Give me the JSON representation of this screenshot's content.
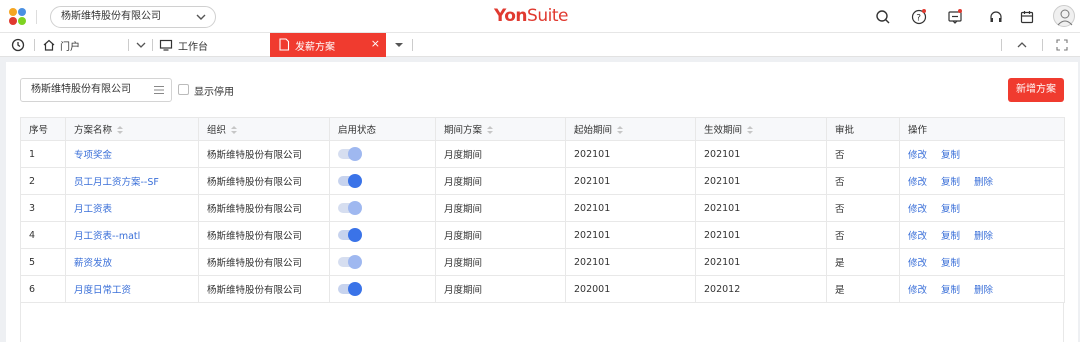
{
  "header": {
    "org_select": "杨斯维特股份有限公司",
    "brand_yon": "Yon",
    "brand_suite": "Suite",
    "icons": [
      "search-icon",
      "help-icon",
      "message-icon",
      "headset-icon",
      "calendar-icon",
      "avatar"
    ],
    "accent": "#e03a30"
  },
  "tabs": {
    "portal": "门户",
    "workbench": "工作台",
    "active": "发薪方案",
    "close": "×"
  },
  "toolbar": {
    "org_value": "杨斯维特股份有限公司",
    "show_disabled": "显示停用",
    "add_button": "新增方案"
  },
  "table": {
    "columns": [
      "序号",
      "方案名称",
      "组织",
      "启用状态",
      "期间方案",
      "起始期间",
      "生效期间",
      "审批",
      "操作"
    ],
    "rows": [
      {
        "no": "1",
        "name": "专项奖金",
        "org": "杨斯维特股份有限公司",
        "enabled": false,
        "period_plan": "月度期间",
        "start": "202101",
        "effective": "202101",
        "approval": "否",
        "actions": [
          "修改",
          "复制"
        ]
      },
      {
        "no": "2",
        "name": "员工月工资方案--SF",
        "org": "杨斯维特股份有限公司",
        "enabled": true,
        "period_plan": "月度期间",
        "start": "202101",
        "effective": "202101",
        "approval": "否",
        "actions": [
          "修改",
          "复制",
          "删除"
        ]
      },
      {
        "no": "3",
        "name": "月工资表",
        "org": "杨斯维特股份有限公司",
        "enabled": false,
        "period_plan": "月度期间",
        "start": "202101",
        "effective": "202101",
        "approval": "否",
        "actions": [
          "修改",
          "复制"
        ]
      },
      {
        "no": "4",
        "name": "月工资表--matl",
        "org": "杨斯维特股份有限公司",
        "enabled": true,
        "period_plan": "月度期间",
        "start": "202101",
        "effective": "202101",
        "approval": "否",
        "actions": [
          "修改",
          "复制",
          "删除"
        ]
      },
      {
        "no": "5",
        "name": "薪资发放",
        "org": "杨斯维特股份有限公司",
        "enabled": false,
        "period_plan": "月度期间",
        "start": "202101",
        "effective": "202101",
        "approval": "是",
        "actions": [
          "修改",
          "复制"
        ]
      },
      {
        "no": "6",
        "name": "月度日常工资",
        "org": "杨斯维特股份有限公司",
        "enabled": true,
        "period_plan": "月度期间",
        "start": "202001",
        "effective": "202012",
        "approval": "是",
        "actions": [
          "修改",
          "复制",
          "删除"
        ]
      }
    ]
  }
}
